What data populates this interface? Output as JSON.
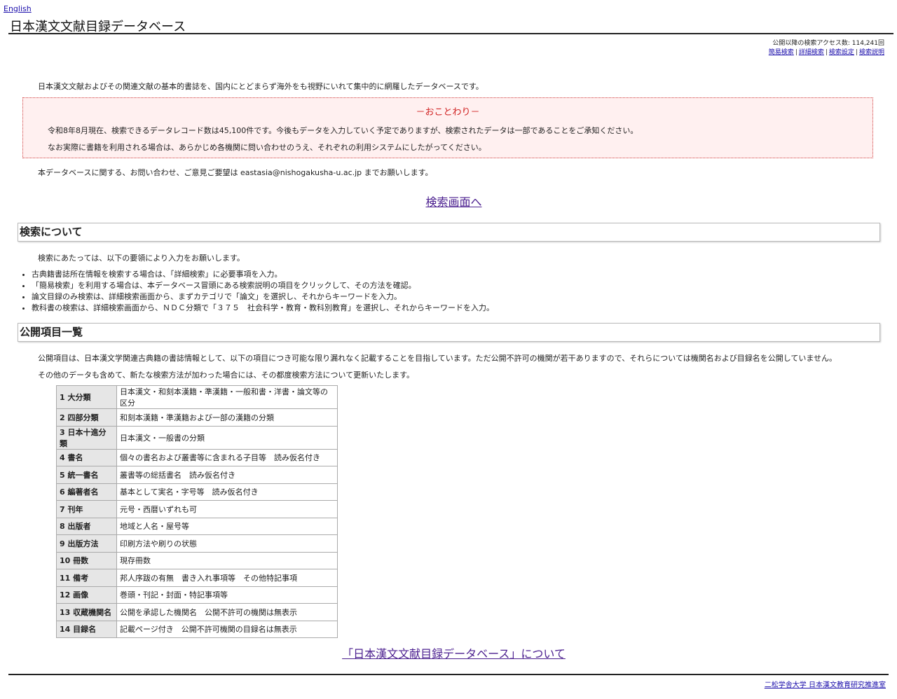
{
  "header": {
    "lang_link": "English",
    "title": "日本漢文文献目録データベース"
  },
  "topbar": {
    "access_count": "公開以降の検索アクセス数: 114,241回",
    "nav": [
      "簡易検索",
      "詳細検索",
      "検索設定",
      "検索説明"
    ]
  },
  "intro": "日本漢文文献およびその関連文献の基本的書誌を、国内にとどまらず海外をも視野にいれて集中的に網羅したデータベースです。",
  "notice": {
    "title": "－おことわり－",
    "line1": "令和8年8月現在、検索できるデータレコード数は45,100件です。今後もデータを入力していく予定でありますが、検索されたデータは一部であることをご承知ください。",
    "line2": "なお実際に書籍を利用される場合は、あらかじめ各機関に問い合わせのうえ、それぞれの利用システムにしたがってください。"
  },
  "contact": "本データベースに関する、お問い合わせ、ご意見ご要望は eastasia@nishogakusha-u.ac.jp までお願いします。",
  "search_link": "検索画面へ",
  "search_section": {
    "heading": "検索について",
    "lead": "検索にあたっては、以下の要領により入力をお願いします。",
    "rules": [
      "古典籍書誌所在情報を検索する場合は、「詳細検索」に必要事項を入力。",
      "「簡易検索」を利用する場合は、本データベース冒頭にある検索説明の項目をクリックして、その方法を確認。",
      "論文目録のみ検索は、詳細検索画面から、まずカテゴリで「論文」を選択し、それからキーワードを入力。",
      "教科書の検索は、詳細検索画面から、ＮＤＣ分類で「３７５　社会科学・教育・教科別教育」を選択し、それからキーワードを入力。"
    ]
  },
  "items_section": {
    "heading": "公開項目一覧",
    "para1": "公開項目は、日本漢文学関連古典籍の書誌情報として、以下の項目につき可能な限り漏れなく記載することを目指しています。ただ公開不許可の機関が若干ありますので、それらについては機関名および目録名を公開していません。",
    "para2": "その他のデータも含めて、新たな検索方法が加わった場合には、その都度検索方法について更新いたします。",
    "table": [
      {
        "key": "1 大分類",
        "value": "日本漢文・和刻本漢籍・準漢籍・一般和書・洋書・論文等の区分"
      },
      {
        "key": "2 四部分類",
        "value": "和刻本漢籍・準漢籍および一部の漢籍の分類"
      },
      {
        "key": "3 日本十進分類",
        "value": "日本漢文・一般書の分類"
      },
      {
        "key": "4 書名",
        "value": "個々の書名および叢書等に含まれる子目等　読み仮名付き"
      },
      {
        "key": "5 統一書名",
        "value": "叢書等の総括書名　読み仮名付き"
      },
      {
        "key": "6 編著者名",
        "value": "基本として実名・字号等　読み仮名付き"
      },
      {
        "key": "7 刊年",
        "value": "元号・西暦いずれも可"
      },
      {
        "key": "8 出版者",
        "value": "地域と人名・屋号等"
      },
      {
        "key": "9 出版方法",
        "value": "印刷方法や刷りの状態"
      },
      {
        "key": "10 冊数",
        "value": "現存冊数"
      },
      {
        "key": "11 備考",
        "value": "邦人序跋の有無　書き入れ事項等　その他特記事項"
      },
      {
        "key": "12 画像",
        "value": "巻頭・刊記・封面・特記事項等"
      },
      {
        "key": "13 収蔵機関名",
        "value": "公開を承認した機関名　公開不許可の機関は無表示"
      },
      {
        "key": "14 目録名",
        "value": "記載ページ付き　公開不許可機関の目録名は無表示"
      }
    ]
  },
  "about_link": "「日本漢文文献目録データベース」について",
  "footer": "二松学舎大学 日本漢文教育研究推進室"
}
